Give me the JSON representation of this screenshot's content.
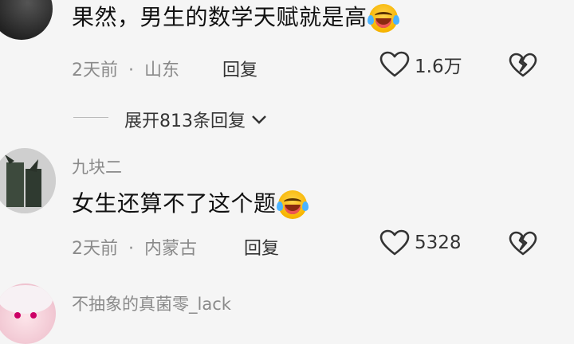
{
  "comments": [
    {
      "text": "果然，男生的数学天赋就是高",
      "date": "2天前",
      "location": "山东",
      "reply_label": "回复",
      "like_count": "1.6万",
      "icons": [
        "crying-laughing-emoji",
        "heart-outline-icon",
        "broken-heart-icon"
      ]
    },
    {
      "username": "九块二",
      "text": "女生还算不了这个题",
      "date": "2天前",
      "location": "内蒙古",
      "reply_label": "回复",
      "like_count": "5328",
      "icons": [
        "crying-laughing-emoji",
        "heart-outline-icon",
        "broken-heart-icon"
      ]
    },
    {
      "username": "不抽象的真菌零_lack"
    }
  ],
  "expand_replies": "展开813条回复",
  "separator_dot": "·",
  "colors": {
    "background": "#f5f5f5",
    "meta": "#8a8a8a",
    "text": "#111111"
  }
}
